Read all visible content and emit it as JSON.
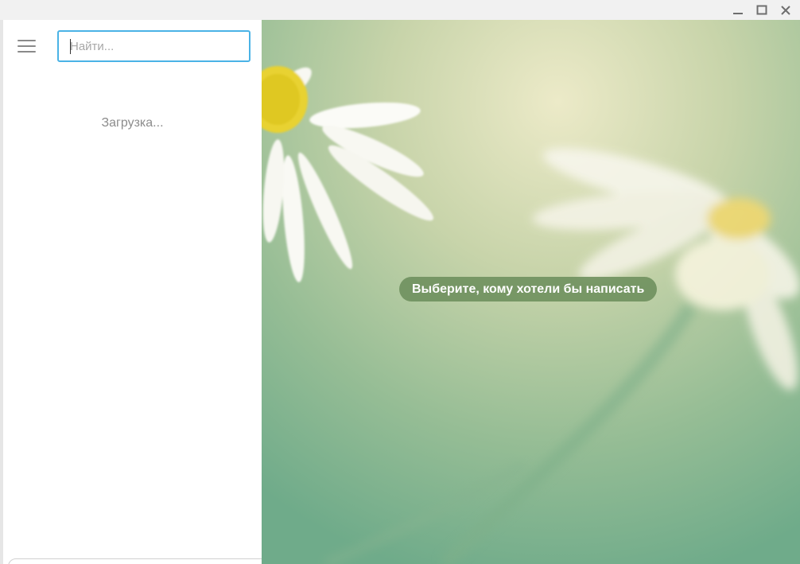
{
  "window": {
    "controls": {
      "minimize_icon": "minimize-icon",
      "maximize_icon": "maximize-icon",
      "close_icon": "close-icon"
    }
  },
  "sidebar": {
    "menu_icon": "hamburger-menu-icon",
    "search": {
      "placeholder": "Найти...",
      "value": ""
    },
    "loading_text": "Загрузка..."
  },
  "chat": {
    "empty_message": "Выберите, кому хотели бы написать"
  },
  "colors": {
    "accent": "#4ab3e6",
    "badge": "#6c8e5c",
    "wallpaper": "#9fc29a"
  }
}
